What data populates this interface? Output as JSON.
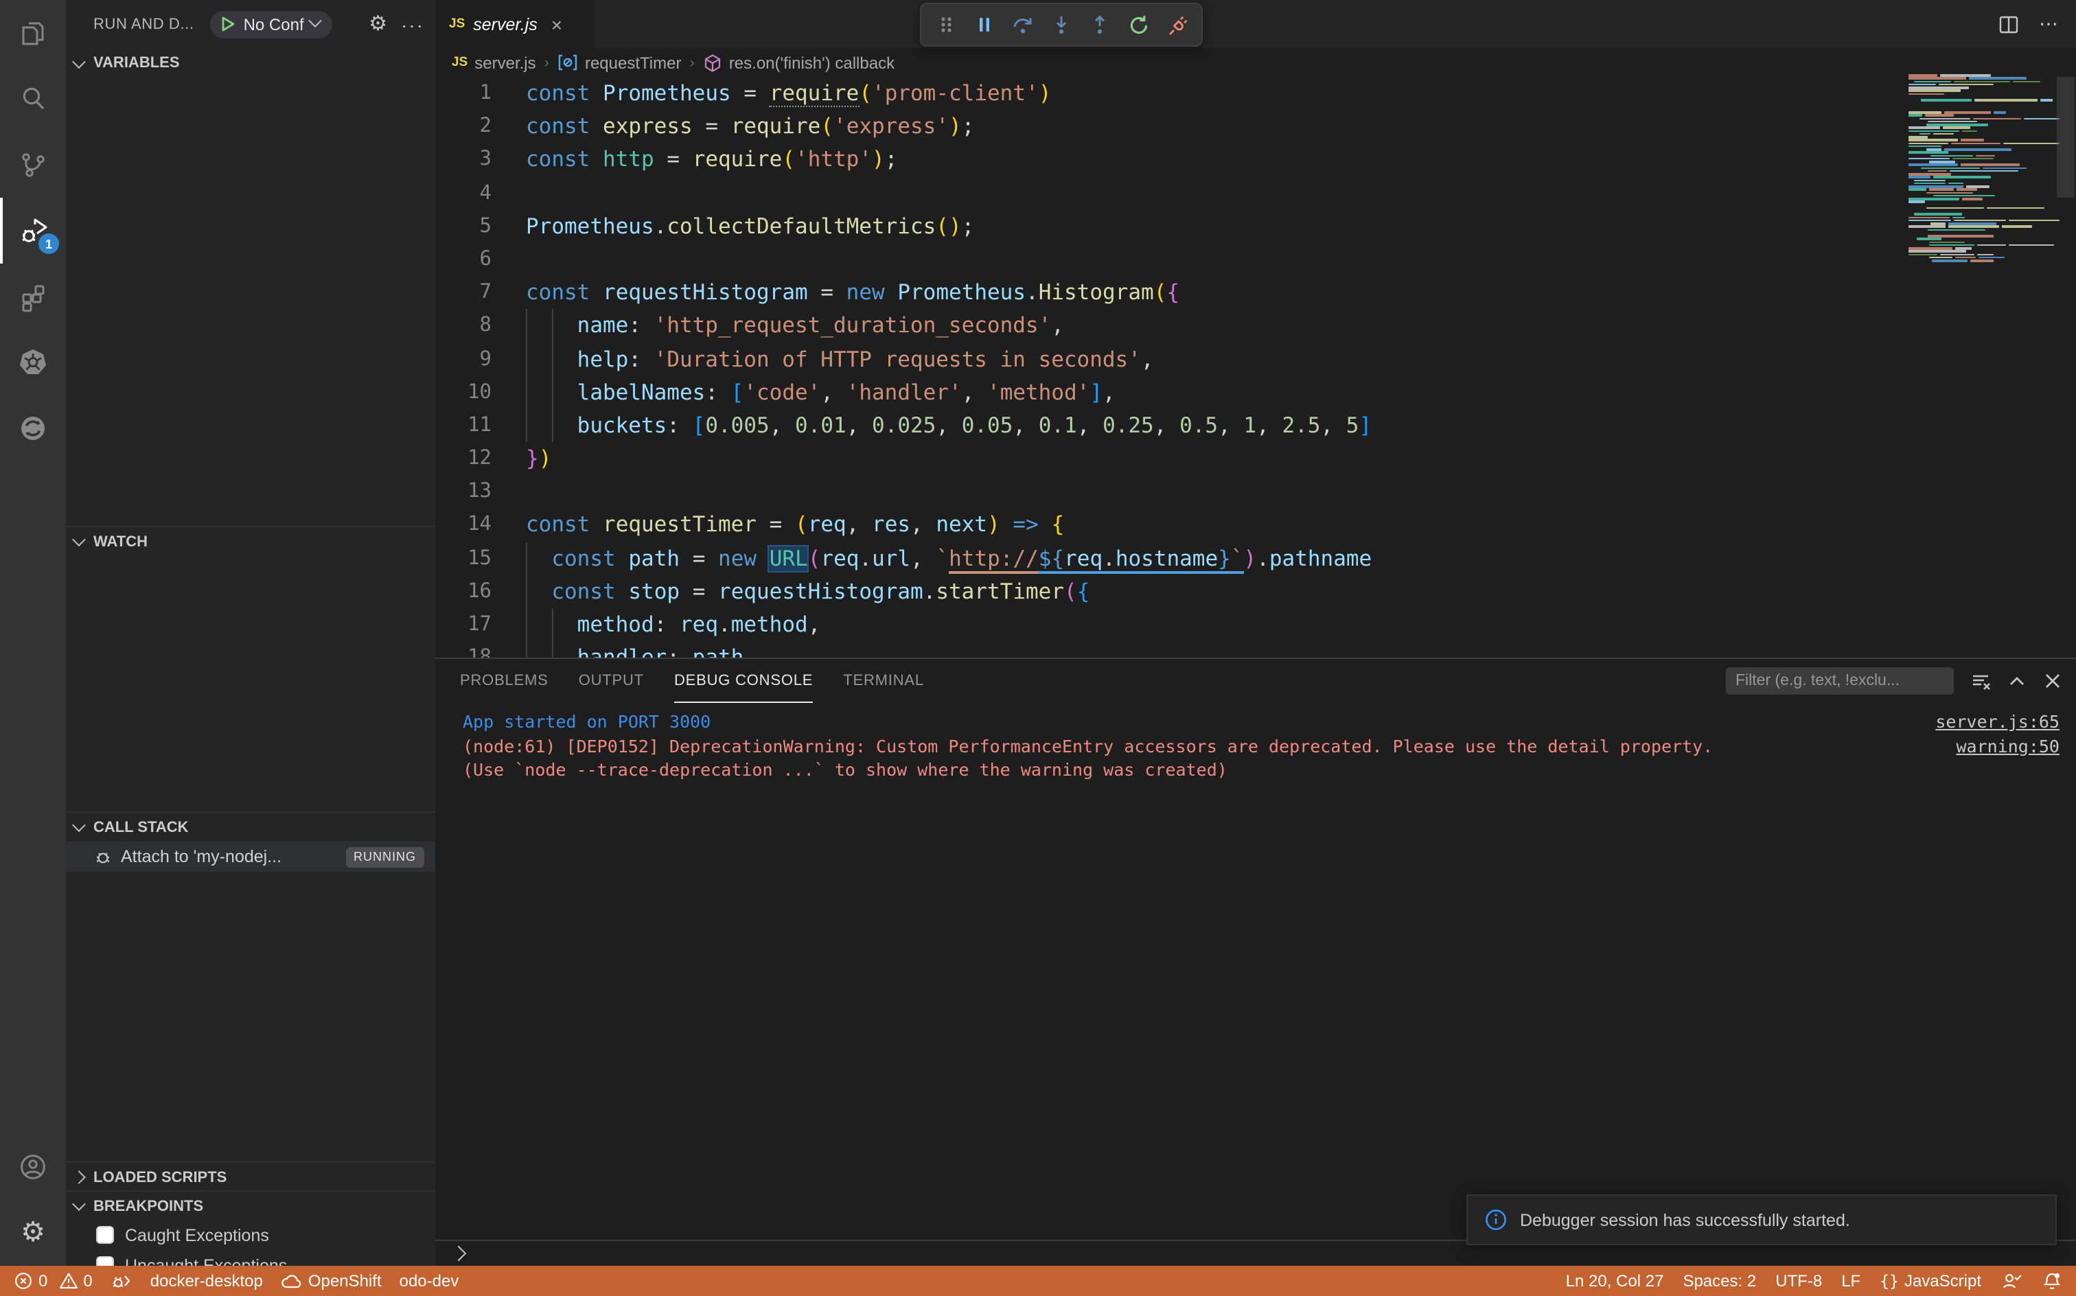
{
  "colors": {
    "status_bar_bg": "#c4632f",
    "activity_badge_bg": "#2f86d1",
    "editor_bg": "#1e1e1e",
    "sidebar_bg": "#252526",
    "activity_bar_bg": "#333333",
    "panel_tab_active_underline": "#e7e7e7",
    "console_info": "#3b8eea",
    "console_warning": "#ef8a80",
    "restart_green": "#89d185",
    "disconnect_red": "#f48771",
    "step_blue": "#75beff"
  },
  "activity_bar": {
    "items": [
      {
        "name": "explorer",
        "active": false
      },
      {
        "name": "search",
        "active": false
      },
      {
        "name": "source-control",
        "active": false
      },
      {
        "name": "run-and-debug",
        "active": true,
        "badge": "1"
      },
      {
        "name": "extensions",
        "active": false
      },
      {
        "name": "kubernetes",
        "active": false
      },
      {
        "name": "openshift",
        "active": false
      }
    ],
    "bottom_items": [
      {
        "name": "accounts"
      },
      {
        "name": "settings"
      }
    ]
  },
  "sidebar": {
    "title": "RUN AND D...",
    "no_config_label": "No Conf",
    "sections": {
      "variables": "VARIABLES",
      "watch": "WATCH",
      "call_stack": "CALL STACK",
      "loaded_scripts": "LOADED SCRIPTS",
      "breakpoints": "BREAKPOINTS"
    },
    "call_stack_item": {
      "label": "Attach to 'my-nodej...",
      "status": "RUNNING"
    },
    "breakpoint_items": [
      "Caught Exceptions",
      "Uncaught Exceptions"
    ]
  },
  "debug_toolbar": {
    "buttons": [
      "drag-grip",
      "pause",
      "step-over",
      "step-into",
      "step-out",
      "restart",
      "disconnect"
    ]
  },
  "editor": {
    "tab": {
      "file_icon": "JS",
      "label": "server.js",
      "close": "×"
    },
    "breadcrumb": {
      "file_icon": "JS",
      "file": "server.js",
      "symbol1": "requestTimer",
      "symbol2": "res.on('finish') callback"
    },
    "code_lines": [
      {
        "n": "1",
        "g": [],
        "tokens": [
          [
            "const",
            "kw"
          ],
          [
            " ",
            "pun"
          ],
          [
            "Prometheus",
            "var"
          ],
          [
            " = ",
            "pun"
          ],
          [
            "require",
            "fn hint"
          ],
          [
            "(",
            "b1"
          ],
          [
            "'prom-client'",
            "str"
          ],
          [
            ")",
            "b1"
          ]
        ]
      },
      {
        "n": "2",
        "g": [],
        "tokens": [
          [
            "const",
            "kw"
          ],
          [
            " ",
            "pun"
          ],
          [
            "express",
            "fn"
          ],
          [
            " = ",
            "pun"
          ],
          [
            "require",
            "fn"
          ],
          [
            "(",
            "b1"
          ],
          [
            "'express'",
            "str"
          ],
          [
            ")",
            "b1"
          ],
          [
            ";",
            "pun"
          ]
        ]
      },
      {
        "n": "3",
        "g": [],
        "tokens": [
          [
            "const",
            "kw"
          ],
          [
            " ",
            "pun"
          ],
          [
            "http",
            "cls"
          ],
          [
            " = ",
            "pun"
          ],
          [
            "require",
            "fn"
          ],
          [
            "(",
            "b1"
          ],
          [
            "'http'",
            "str"
          ],
          [
            ")",
            "b1"
          ],
          [
            ";",
            "pun"
          ]
        ]
      },
      {
        "n": "4",
        "g": [],
        "tokens": []
      },
      {
        "n": "5",
        "g": [],
        "tokens": [
          [
            "Prometheus",
            "var"
          ],
          [
            ".",
            "pun"
          ],
          [
            "collectDefaultMetrics",
            "fn"
          ],
          [
            "(",
            "b1"
          ],
          [
            ")",
            "b1"
          ],
          [
            ";",
            "pun"
          ]
        ]
      },
      {
        "n": "6",
        "g": [],
        "tokens": []
      },
      {
        "n": "7",
        "g": [],
        "tokens": [
          [
            "const",
            "kw"
          ],
          [
            " ",
            "pun"
          ],
          [
            "requestHistogram",
            "var"
          ],
          [
            " = ",
            "pun"
          ],
          [
            "new",
            "kw"
          ],
          [
            " ",
            "pun"
          ],
          [
            "Prometheus",
            "var"
          ],
          [
            ".",
            "pun"
          ],
          [
            "Histogram",
            "fn"
          ],
          [
            "(",
            "b1"
          ],
          [
            "{",
            "b2"
          ]
        ]
      },
      {
        "n": "8",
        "g": [
          0,
          2
        ],
        "tokens": [
          [
            "    ",
            "pun"
          ],
          [
            "name",
            "var"
          ],
          [
            ": ",
            "pun"
          ],
          [
            "'http_request_duration_seconds'",
            "str"
          ],
          [
            ",",
            "pun"
          ]
        ]
      },
      {
        "n": "9",
        "g": [
          0,
          2
        ],
        "tokens": [
          [
            "    ",
            "pun"
          ],
          [
            "help",
            "var"
          ],
          [
            ": ",
            "pun"
          ],
          [
            "'Duration of HTTP requests in seconds'",
            "str"
          ],
          [
            ",",
            "pun"
          ]
        ]
      },
      {
        "n": "10",
        "g": [
          0,
          2
        ],
        "tokens": [
          [
            "    ",
            "pun"
          ],
          [
            "labelNames",
            "var"
          ],
          [
            ": ",
            "pun"
          ],
          [
            "[",
            "b3"
          ],
          [
            "'code'",
            "str"
          ],
          [
            ", ",
            "pun"
          ],
          [
            "'handler'",
            "str"
          ],
          [
            ", ",
            "pun"
          ],
          [
            "'method'",
            "str"
          ],
          [
            "]",
            "b3"
          ],
          [
            ",",
            "pun"
          ]
        ]
      },
      {
        "n": "11",
        "g": [
          0,
          2
        ],
        "tokens": [
          [
            "    ",
            "pun"
          ],
          [
            "buckets",
            "var"
          ],
          [
            ": ",
            "pun"
          ],
          [
            "[",
            "b3"
          ],
          [
            "0.005",
            "num"
          ],
          [
            ", ",
            "pun"
          ],
          [
            "0.01",
            "num"
          ],
          [
            ", ",
            "pun"
          ],
          [
            "0.025",
            "num"
          ],
          [
            ", ",
            "pun"
          ],
          [
            "0.05",
            "num"
          ],
          [
            ", ",
            "pun"
          ],
          [
            "0.1",
            "num"
          ],
          [
            ", ",
            "pun"
          ],
          [
            "0.25",
            "num"
          ],
          [
            ", ",
            "pun"
          ],
          [
            "0.5",
            "num"
          ],
          [
            ", ",
            "pun"
          ],
          [
            "1",
            "num"
          ],
          [
            ", ",
            "pun"
          ],
          [
            "2.5",
            "num"
          ],
          [
            ", ",
            "pun"
          ],
          [
            "5",
            "num"
          ],
          [
            "]",
            "b3"
          ]
        ]
      },
      {
        "n": "12",
        "g": [],
        "tokens": [
          [
            "}",
            "b2"
          ],
          [
            ")",
            "b1"
          ]
        ]
      },
      {
        "n": "13",
        "g": [],
        "tokens": []
      },
      {
        "n": "14",
        "g": [],
        "tokens": [
          [
            "const",
            "kw"
          ],
          [
            " ",
            "pun"
          ],
          [
            "requestTimer",
            "fn"
          ],
          [
            " = ",
            "pun"
          ],
          [
            "(",
            "b1"
          ],
          [
            "req",
            "var"
          ],
          [
            ", ",
            "pun"
          ],
          [
            "res",
            "var"
          ],
          [
            ", ",
            "pun"
          ],
          [
            "next",
            "var"
          ],
          [
            ")",
            "b1"
          ],
          [
            " ",
            "pun"
          ],
          [
            "=>",
            "kw"
          ],
          [
            " ",
            "pun"
          ],
          [
            "{",
            "b1"
          ]
        ]
      },
      {
        "n": "15",
        "g": [
          0
        ],
        "tokens": [
          [
            "  ",
            "pun"
          ],
          [
            "const",
            "kw"
          ],
          [
            " ",
            "pun"
          ],
          [
            "path",
            "var"
          ],
          [
            " = ",
            "pun"
          ],
          [
            "new",
            "kw"
          ],
          [
            " ",
            "pun"
          ],
          [
            "URL",
            "cls hl"
          ],
          [
            "(",
            "b2"
          ],
          [
            "req",
            "var"
          ],
          [
            ".",
            "pun"
          ],
          [
            "url",
            "var"
          ],
          [
            ", ",
            "pun"
          ],
          [
            "`",
            "str"
          ],
          [
            "http://",
            "str ul-tan"
          ],
          [
            "${",
            "tpl ul-blue"
          ],
          [
            "req",
            "var ul-blue"
          ],
          [
            ".",
            "pun ul-blue"
          ],
          [
            "hostname",
            "var ul-blue"
          ],
          [
            "}",
            "tpl ul-blue"
          ],
          [
            "`",
            "str ul-blue"
          ],
          [
            ")",
            "b2"
          ],
          [
            ".",
            "pun"
          ],
          [
            "pathname",
            "var"
          ]
        ]
      },
      {
        "n": "16",
        "g": [
          0
        ],
        "tokens": [
          [
            "  ",
            "pun"
          ],
          [
            "const",
            "kw"
          ],
          [
            " ",
            "pun"
          ],
          [
            "stop",
            "var"
          ],
          [
            " = ",
            "pun"
          ],
          [
            "requestHistogram",
            "var"
          ],
          [
            ".",
            "pun"
          ],
          [
            "startTimer",
            "fn"
          ],
          [
            "(",
            "b2"
          ],
          [
            "{",
            "b3"
          ]
        ]
      },
      {
        "n": "17",
        "g": [
          0,
          2
        ],
        "tokens": [
          [
            "    ",
            "pun"
          ],
          [
            "method",
            "var"
          ],
          [
            ": ",
            "pun"
          ],
          [
            "req",
            "var"
          ],
          [
            ".",
            "pun"
          ],
          [
            "method",
            "var"
          ],
          [
            ",",
            "pun"
          ]
        ]
      },
      {
        "n": "18",
        "g": [
          0,
          2
        ],
        "tokens": [
          [
            "    ",
            "pun"
          ],
          [
            "handler",
            "var"
          ],
          [
            ": ",
            "pun"
          ],
          [
            "path",
            "var"
          ]
        ]
      }
    ]
  },
  "panel": {
    "tabs": [
      "PROBLEMS",
      "OUTPUT",
      "DEBUG CONSOLE",
      "TERMINAL"
    ],
    "active_tab": "DEBUG CONSOLE",
    "filter_placeholder": "Filter (e.g. text, !exclu...",
    "console_rows": [
      {
        "text": "App started on PORT 3000",
        "cls": "log-blue",
        "link": "server.js:65"
      },
      {
        "text": "(node:61) [DEP0152] DeprecationWarning: Custom PerformanceEntry accessors are deprecated. Please use the detail property.",
        "cls": "log-warn",
        "link": "warning:50"
      },
      {
        "text": "(Use `node --trace-deprecation ...` to show where the warning was created)",
        "cls": "log-warn",
        "link": ""
      }
    ]
  },
  "status_bar": {
    "errors": "0",
    "warnings": "0",
    "docker_context": "docker-desktop",
    "openshift_label": "OpenShift",
    "odo_label": "odo-dev",
    "line_col": "Ln 20, Col 27",
    "spaces": "Spaces: 2",
    "encoding": "UTF-8",
    "eol": "LF",
    "language": "JavaScript"
  },
  "notification": {
    "message": "Debugger session has successfully started."
  }
}
